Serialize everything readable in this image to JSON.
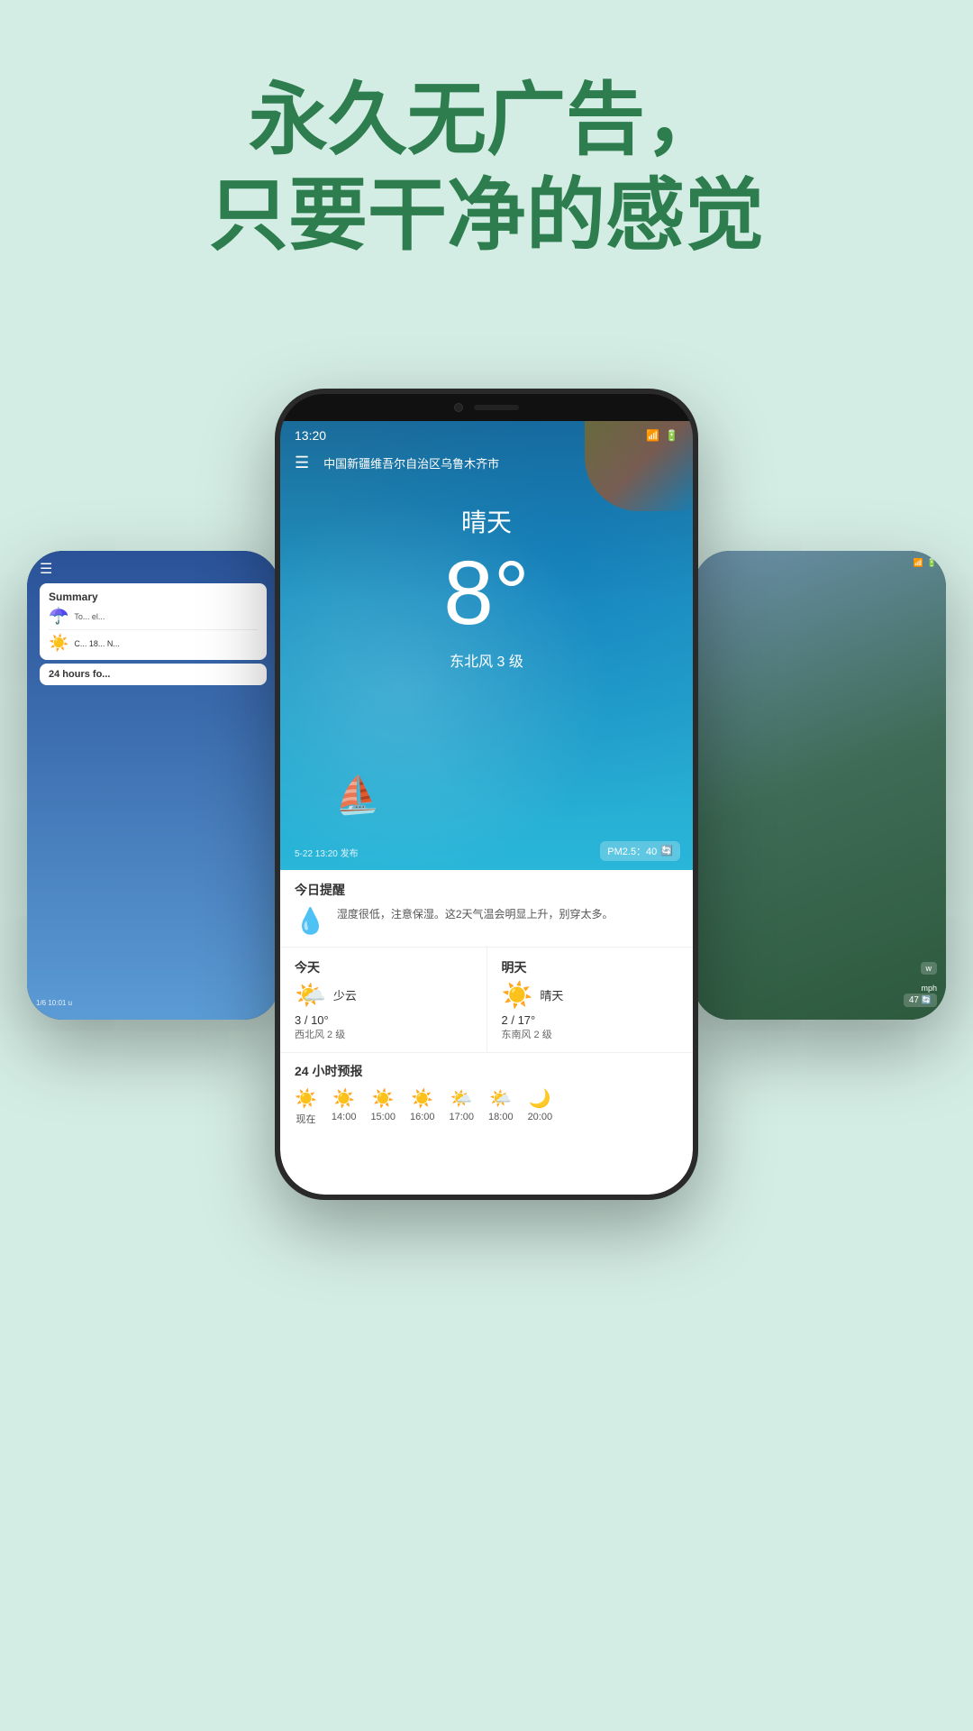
{
  "page": {
    "background_color": "#d4ede4",
    "headline_line1": "永久无广告，",
    "headline_line2": "只要干净的感觉",
    "headline_color": "#2e7d4f"
  },
  "center_phone": {
    "status_time": "13:20",
    "wifi_icon": "📶",
    "battery_icon": "🔋",
    "menu_icon": "☰",
    "location": "中国新疆维吾尔自治区乌鲁木齐市",
    "weather_condition": "晴天",
    "temperature": "8°",
    "wind": "东北风 3 级",
    "publish_time": "5-22 13:20 发布",
    "pm25": "PM2.5：40",
    "reminder_title": "今日提醒",
    "reminder_text": "湿度很低，注意保湿。这2天气温会明显上升，别穿太多。",
    "today_label": "今天",
    "today_condition": "少云",
    "today_temp": "3 / 10°",
    "today_wind": "西北风 2 级",
    "tomorrow_label": "明天",
    "tomorrow_condition": "晴天",
    "tomorrow_temp": "2 / 17°",
    "tomorrow_wind": "东南风 2 级",
    "hourly_title": "24 小时预报",
    "hourly_items": [
      {
        "time": "现在",
        "icon": "☀️"
      },
      {
        "time": "14:00",
        "icon": "☀️"
      },
      {
        "time": "15:00",
        "icon": "☀️"
      },
      {
        "time": "16:00",
        "icon": "☀️"
      },
      {
        "time": "17:00",
        "icon": "🌤️"
      },
      {
        "time": "18:00",
        "icon": "🌤️"
      },
      {
        "time": "20:00",
        "icon": "🌙"
      }
    ]
  },
  "left_phone": {
    "date_badge": "1/6 10:01 u",
    "summary_label": "Summary",
    "umbrella_text": "To... el...",
    "today_label": "To",
    "today_text": "C... 18... N...",
    "hours_label": "24 hours fo..."
  },
  "right_phone": {
    "pm_badge": "47",
    "wind_label": "w",
    "mph_label": "mph"
  }
}
